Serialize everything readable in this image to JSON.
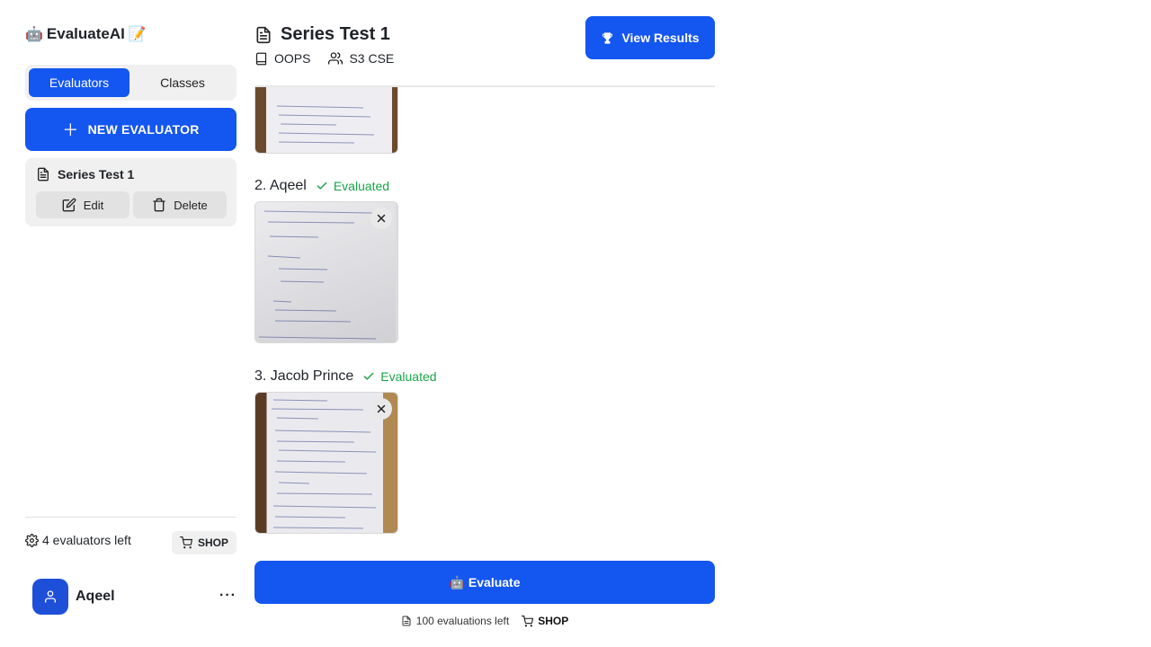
{
  "app": {
    "title": "EvaluateAI",
    "logo_emoji": "🤖",
    "title_emoji": "📝"
  },
  "sidebar": {
    "tabs": [
      {
        "label": "Evaluators",
        "active": true
      },
      {
        "label": "Classes",
        "active": false
      }
    ],
    "new_button": "NEW EVALUATOR",
    "evaluator": {
      "name": "Series Test 1",
      "edit_label": "Edit",
      "delete_label": "Delete"
    },
    "evaluators_left": "4 evaluators left",
    "shop_label": "SHOP",
    "user": {
      "name": "Aqeel",
      "menu": "···"
    }
  },
  "header": {
    "title": "Series Test 1",
    "subject": "OOPS",
    "class_name": "S3 CSE",
    "view_results": "View Results"
  },
  "submissions": [
    {
      "label": "2. Aqeel",
      "status": "Evaluated"
    },
    {
      "label": "3. Jacob Prince",
      "status": "Evaluated"
    }
  ],
  "actions": {
    "evaluate_label": "Evaluate",
    "evaluate_emoji": "🤖",
    "evaluations_left": "100 evaluations left",
    "shop_label": "SHOP"
  },
  "colors": {
    "primary": "#1456f0",
    "success": "#1aa34a"
  }
}
